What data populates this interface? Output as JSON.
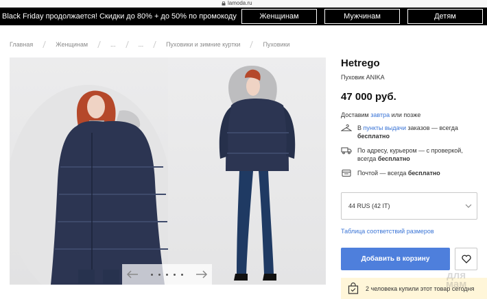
{
  "browser": {
    "url": "lamoda.ru"
  },
  "promo": {
    "text": "Black Friday продолжается! Скидки до 80% + до 50% по промокоду",
    "nav": [
      "Женщинам",
      "Мужчинам",
      "Детям"
    ]
  },
  "breadcrumb": [
    "Главная",
    "Женщинам",
    "...",
    "...",
    "Пуховики и зимние куртки",
    "Пуховики"
  ],
  "product": {
    "brand": "Hetrego",
    "model": "Пуховик ANIKA",
    "price": "47 000 руб."
  },
  "delivery": {
    "prefix": "Доставим ",
    "link": "завтра",
    "suffix": " или позже",
    "rows": [
      {
        "icon": "hanger-icon",
        "pre": "В ",
        "link": "пункты выдачи",
        "mid": " заказов — всегда",
        "bold": "бесплатно"
      },
      {
        "icon": "truck-icon",
        "pre": "По адресу, курьером — с проверкой, всегда ",
        "link": "",
        "mid": "",
        "bold": "бесплатно"
      },
      {
        "icon": "mailbox-icon",
        "pre": "Почтой — всегда ",
        "link": "",
        "mid": "",
        "bold": "бесплатно"
      }
    ]
  },
  "size": {
    "selected": "44 RUS (42 IT)",
    "table_link": "Таблица соответствий размеров"
  },
  "actions": {
    "cart": "Добавить в корзину"
  },
  "social": {
    "bought": "2 человека купили этот товар сегодня"
  },
  "gallery": {
    "current_slide": 1,
    "slides": 5
  },
  "watermark": {
    "line1": "для",
    "line2": "мам"
  },
  "colors": {
    "accent": "#4e7fdc",
    "link": "#3b75d6",
    "promo_bg": "#000000",
    "bought_bg": "#fff6d9"
  }
}
